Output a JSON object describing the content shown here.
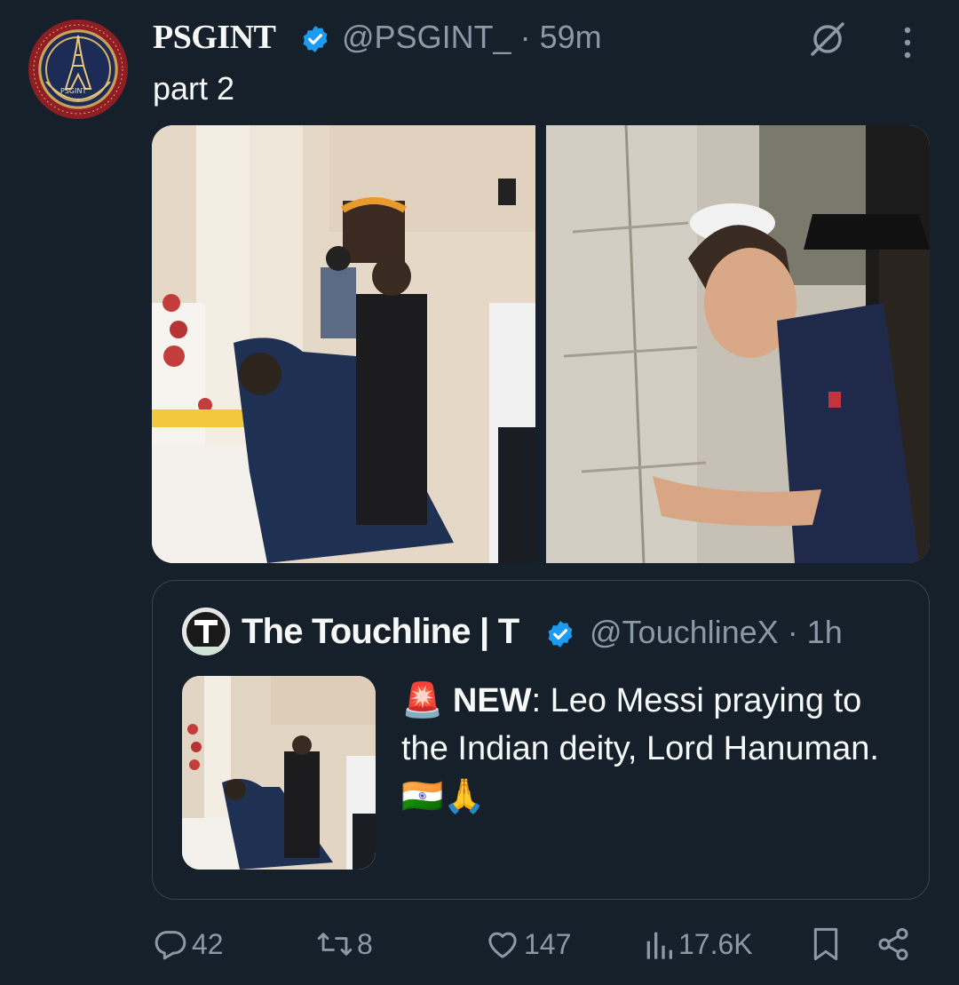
{
  "tweet": {
    "author_name": "PSGINT",
    "handle": "@PSGINT_",
    "time": "· 59m",
    "text": "part 2",
    "avatar_text": "PSGINT"
  },
  "quoted": {
    "author_name": "The Touchline | T",
    "handle": "@TouchlineX",
    "time": "· 1h",
    "text_bold": "NEW",
    "text_after_bold": ": Leo Messi praying to the Indian deity, Lord Hanuman.",
    "emoji_siren": "🚨",
    "emoji_flag": "🇮🇳",
    "emoji_pray": "🙏"
  },
  "actions": {
    "replies": "42",
    "reposts": "8",
    "likes": "147",
    "views": "17.6K"
  },
  "colors": {
    "background": "#15202b",
    "text_primary": "#f7f9f9",
    "text_secondary": "#8b98a5",
    "verified_blue": "#1d9bf0",
    "border": "#38444d"
  },
  "icons": [
    "verified-badge-icon",
    "grok-icon",
    "more-icon",
    "reply-icon",
    "repost-icon",
    "like-icon",
    "views-icon",
    "bookmark-icon",
    "share-icon"
  ]
}
